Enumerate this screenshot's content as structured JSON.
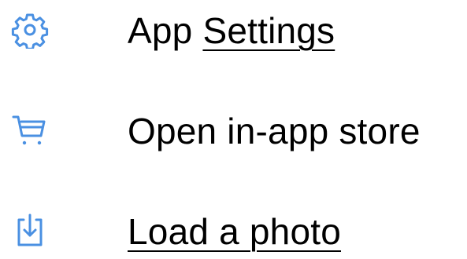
{
  "accent_color": "#4a90e2",
  "menu": {
    "items": [
      {
        "icon": "gear-icon",
        "label_plain": "App ",
        "label_link": "Settings"
      },
      {
        "icon": "cart-icon",
        "label": "Open in-app store"
      },
      {
        "icon": "download-icon",
        "label_link": "Load a photo"
      }
    ]
  }
}
